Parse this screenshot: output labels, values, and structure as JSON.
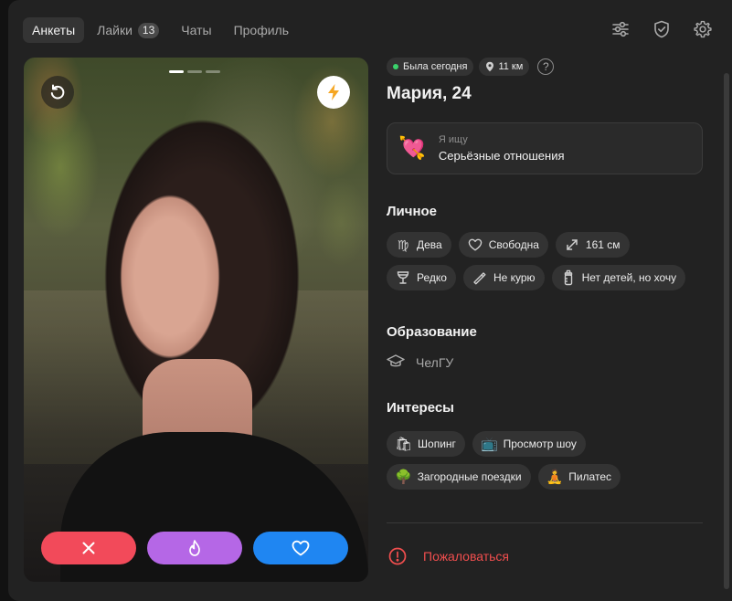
{
  "nav": {
    "tabs": [
      {
        "label": "Анкеты"
      },
      {
        "label": "Лайки",
        "badge": "13"
      },
      {
        "label": "Чаты"
      },
      {
        "label": "Профиль"
      }
    ],
    "icons": [
      "filters-icon",
      "shield-check-icon",
      "gear-icon"
    ]
  },
  "photo": {
    "pages_total": 3,
    "page_current": 1
  },
  "profile": {
    "status": "Была сегодня",
    "distance": "11 км",
    "help": "?",
    "name": "Мария, 24",
    "looking_label": "Я ищу",
    "looking_value": "Серьёзные отношения",
    "looking_emoji": "💘"
  },
  "personal": {
    "title": "Личное",
    "chips": [
      {
        "label": "Дева",
        "icon": "virgo-icon"
      },
      {
        "label": "Свободна",
        "icon": "heart-outline-icon"
      },
      {
        "label": "161 см",
        "icon": "height-arrows-icon"
      },
      {
        "label": "Редко",
        "icon": "wine-glass-icon"
      },
      {
        "label": "Не курю",
        "icon": "cigarette-icon"
      },
      {
        "label": "Нет детей, но хочу",
        "icon": "baby-bottle-icon"
      }
    ]
  },
  "education": {
    "title": "Образование",
    "value": "ЧелГУ"
  },
  "interests": {
    "title": "Интересы",
    "chips": [
      {
        "label": "Шопинг",
        "emoji": "🛍"
      },
      {
        "label": "Просмотр шоу",
        "emoji": "📺"
      },
      {
        "label": "Загородные поездки",
        "emoji": "🌳"
      },
      {
        "label": "Пилатес",
        "emoji": "🧘"
      }
    ]
  },
  "report": {
    "label": "Пожаловаться"
  },
  "colors": {
    "dislike": "#f24a5a",
    "superlike": "#b567e6",
    "like": "#1f86f2",
    "report": "#f04e4e",
    "online": "#3ad26b"
  }
}
